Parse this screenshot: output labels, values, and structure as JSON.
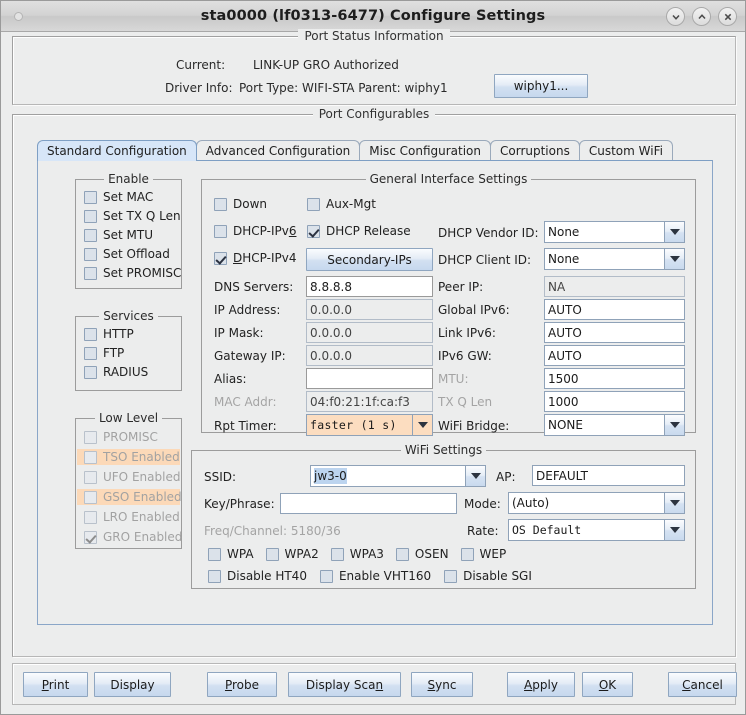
{
  "window": {
    "title": "sta0000  (lf0313-6477) Configure Settings",
    "buttons": [
      {
        "name": "minimize",
        "glyph": "chevron-down"
      },
      {
        "name": "maximize",
        "glyph": "chevron-up"
      },
      {
        "name": "close",
        "glyph": "x"
      }
    ]
  },
  "status_panel": {
    "title": "Port Status Information",
    "current_label": "Current:",
    "current_value": "LINK-UP GRO  Authorized",
    "driver_label": "Driver Info:",
    "driver_value": "Port Type: WIFI-STA   Parent: wiphy1",
    "wiphy_button": "wiphy1..."
  },
  "config_panel": {
    "title": "Port Configurables",
    "tabs": [
      {
        "label": "Standard Configuration",
        "selected": true
      },
      {
        "label": "Advanced Configuration",
        "selected": false
      },
      {
        "label": "Misc Configuration",
        "selected": false
      },
      {
        "label": "Corruptions",
        "selected": false
      },
      {
        "label": "Custom WiFi",
        "selected": false
      }
    ]
  },
  "enable_group": {
    "title": "Enable",
    "items": [
      {
        "label": "Set MAC",
        "checked": false
      },
      {
        "label": "Set TX Q Len",
        "checked": false
      },
      {
        "label": "Set MTU",
        "checked": false
      },
      {
        "label": "Set Offload",
        "checked": false
      },
      {
        "label": "Set PROMISC",
        "checked": false
      }
    ]
  },
  "services_group": {
    "title": "Services",
    "items": [
      {
        "label": "HTTP",
        "checked": false
      },
      {
        "label": "FTP",
        "checked": false
      },
      {
        "label": "RADIUS",
        "checked": false
      }
    ]
  },
  "lowlevel_group": {
    "title": "Low Level",
    "items": [
      {
        "label": "PROMISC",
        "checked": false,
        "highlight": false
      },
      {
        "label": "TSO Enabled",
        "checked": false,
        "highlight": true
      },
      {
        "label": "UFO Enabled",
        "checked": false,
        "highlight": false
      },
      {
        "label": "GSO Enabled",
        "checked": false,
        "highlight": true
      },
      {
        "label": "LRO Enabled",
        "checked": false,
        "highlight": false
      },
      {
        "label": "GRO Enabled",
        "checked": true,
        "highlight": false
      }
    ]
  },
  "general": {
    "title": "General Interface Settings",
    "checks": {
      "down": {
        "label": "Down",
        "checked": false
      },
      "aux_mgt": {
        "label": "Aux-Mgt",
        "checked": false
      },
      "dhcp_ipv6": {
        "label": "DHCP-IPv6",
        "checked": false
      },
      "dhcp_release": {
        "label": "DHCP Release",
        "checked": true
      },
      "dhcp_ipv4": {
        "label": "DHCP-IPv4",
        "checked": true
      }
    },
    "secondary_ips_button": "Secondary-IPs",
    "left_labels": {
      "dns": "DNS Servers:",
      "ip_address": "IP Address:",
      "ip_mask": "IP Mask:",
      "gateway": "Gateway IP:",
      "alias": "Alias:",
      "mac_addr": "MAC Addr:",
      "rpt_timer": "Rpt Timer:"
    },
    "left_values": {
      "dns": "8.8.8.8",
      "ip_address": "0.0.0.0",
      "ip_mask": "0.0.0.0",
      "gateway": "0.0.0.0",
      "alias": "",
      "mac_addr": "04:f0:21:1f:ca:f3",
      "rpt_timer": "faster  (1 s)"
    },
    "right_labels": {
      "dhcp_vendor": "DHCP Vendor ID:",
      "dhcp_client": "DHCP Client ID:",
      "peer_ip": "Peer IP:",
      "global_ipv6": "Global IPv6:",
      "link_ipv6": "Link IPv6:",
      "ipv6_gw": "IPv6 GW:",
      "mtu": "MTU:",
      "tx_q_len": "TX Q Len",
      "wifi_bridge": "WiFi Bridge:"
    },
    "right_values": {
      "dhcp_vendor": "None",
      "dhcp_client": "None",
      "peer_ip": "NA",
      "global_ipv6": "AUTO",
      "link_ipv6": "AUTO",
      "ipv6_gw": "AUTO",
      "mtu": "1500",
      "tx_q_len": "1000",
      "wifi_bridge": "NONE"
    }
  },
  "wifi": {
    "title": "WiFi Settings",
    "labels": {
      "ssid": "SSID:",
      "key": "Key/Phrase:",
      "freq": "Freq/Channel: 5180/36",
      "ap": "AP:",
      "mode": "Mode:",
      "rate": "Rate:"
    },
    "values": {
      "ssid": "jw3-0",
      "key": "",
      "ap": "DEFAULT",
      "mode": "(Auto)",
      "rate": "OS Default"
    },
    "security_checks": [
      {
        "label": "WPA",
        "checked": false
      },
      {
        "label": "WPA2",
        "checked": false
      },
      {
        "label": "WPA3",
        "checked": false
      },
      {
        "label": "OSEN",
        "checked": false
      },
      {
        "label": "WEP",
        "checked": false
      }
    ],
    "option_checks": [
      {
        "label": "Disable HT40",
        "checked": false
      },
      {
        "label": "Enable VHT160",
        "checked": false
      },
      {
        "label": "Disable SGI",
        "checked": false
      }
    ]
  },
  "bottom_buttons": [
    {
      "label": "Print",
      "mnemonic": "P"
    },
    {
      "label": "Display",
      "mnemonic": ""
    },
    {
      "label": "Probe",
      "mnemonic": "P"
    },
    {
      "label": "Display Scan",
      "mnemonic": "n"
    },
    {
      "label": "Sync",
      "mnemonic": "S"
    },
    {
      "label": "Apply",
      "mnemonic": "A"
    },
    {
      "label": "OK",
      "mnemonic": "O"
    },
    {
      "label": "Cancel",
      "mnemonic": "C"
    }
  ],
  "colors": {
    "accent_blue": "#c6d8ee",
    "tab_selected": "#d7e6f8",
    "highlight_orange": "#fcddc0",
    "selection_blue": "#bcd4ef",
    "panel_bg": "#eceded"
  }
}
